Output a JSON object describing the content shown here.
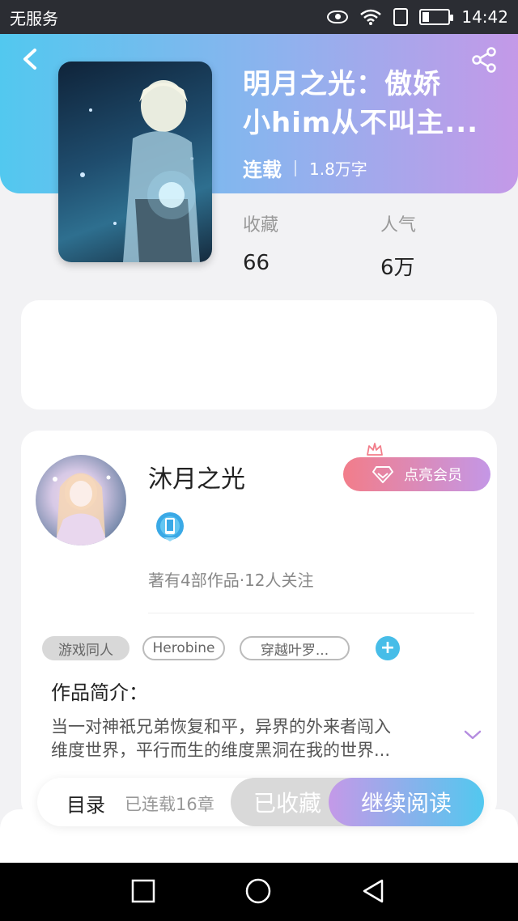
{
  "status_bar": {
    "carrier": "无服务",
    "time": "14:42",
    "icons": [
      "eye-icon",
      "wifi-icon",
      "sim-icon",
      "battery-icon"
    ]
  },
  "header": {
    "back_icon": "chevron-left-icon",
    "share_icon": "share-icon"
  },
  "book": {
    "title_line1": "明月之光：傲娇",
    "title_line2": "小him从不叫主...",
    "status": "连载",
    "word_count": "1.8万字",
    "stats": [
      {
        "label": "收藏",
        "value": "66"
      },
      {
        "label": "人气",
        "value": "6万"
      }
    ]
  },
  "author": {
    "name": "沐月之光",
    "vip_button": "点亮会员",
    "stats": "著有4部作品·12人关注"
  },
  "tags": [
    "游戏同人",
    "Herobine",
    "穿越叶罗..."
  ],
  "intro": {
    "title": "作品简介：",
    "line1": "当一对神祇兄弟恢复和平，异界的外来者闯入",
    "line2": "维度世界，平行而生的维度黑洞在我的世界..."
  },
  "actions": {
    "catalog": "目录",
    "chapters": "已连载16章",
    "favorited": "已收藏",
    "continue_reading": "继续阅读"
  },
  "colors": {
    "gradient_start": "#52c8ef",
    "gradient_end": "#c499e8",
    "vip_start": "#f27d8a",
    "tag_add": "#47bde8"
  }
}
